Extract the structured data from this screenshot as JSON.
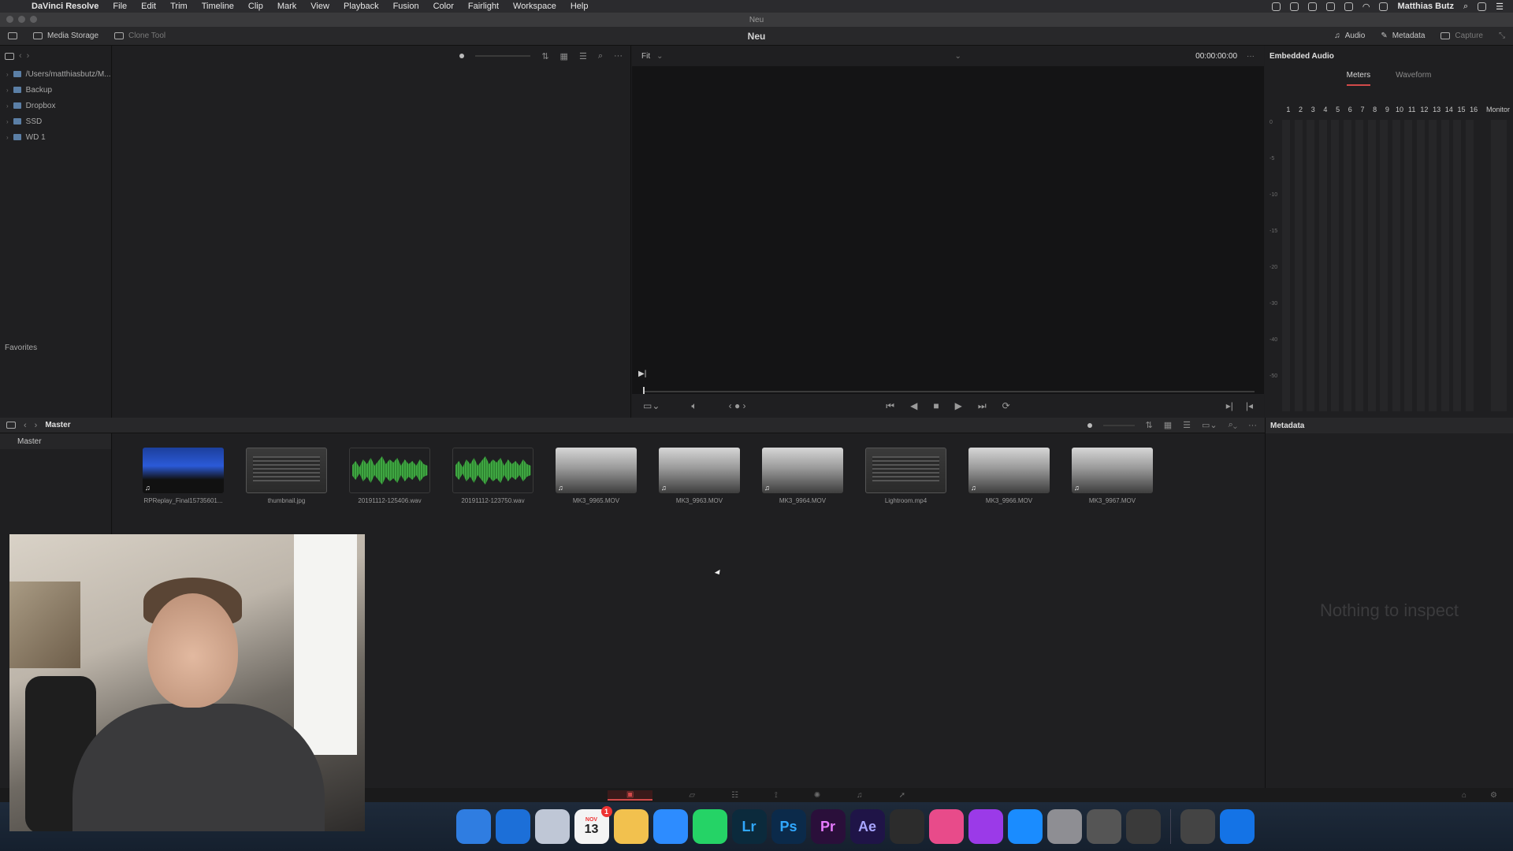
{
  "menubar": {
    "app_name": "DaVinci Resolve",
    "menus": [
      "File",
      "Edit",
      "Trim",
      "Timeline",
      "Clip",
      "Mark",
      "View",
      "Playback",
      "Fusion",
      "Color",
      "Fairlight",
      "Workspace",
      "Help"
    ],
    "user": "Matthias Butz"
  },
  "window": {
    "title": "Neu"
  },
  "toolbar": {
    "media_storage": "Media Storage",
    "clone_tool": "Clone Tool",
    "project_title": "Neu",
    "audio": "Audio",
    "metadata": "Metadata",
    "capture": "Capture"
  },
  "tree": {
    "items": [
      "/Users/matthiasbutz/M...",
      "Backup",
      "Dropbox",
      "SSD",
      "WD 1"
    ],
    "favorites": "Favorites"
  },
  "viewer": {
    "zoom": "Fit",
    "timecode": "00:00:00:00"
  },
  "inspector": {
    "title": "Embedded Audio",
    "tabs": [
      "Meters",
      "Waveform"
    ],
    "active_tab": "Meters",
    "channels": [
      "1",
      "2",
      "3",
      "4",
      "5",
      "6",
      "7",
      "8",
      "9",
      "10",
      "11",
      "12",
      "13",
      "14",
      "15",
      "16"
    ],
    "monitor": "Monitor",
    "db_scale": [
      "0",
      "-5",
      "-10",
      "-15",
      "-20",
      "-30",
      "-40",
      "-50"
    ]
  },
  "bin": {
    "title": "Master",
    "list_item": "Master"
  },
  "clips": [
    {
      "name": "RPReplay_Final15735601...",
      "kind": "replay",
      "audio": true
    },
    {
      "name": "thumbnail.jpg",
      "kind": "screen",
      "audio": false
    },
    {
      "name": "20191112-125406.wav",
      "kind": "audio",
      "audio": false
    },
    {
      "name": "20191112-123750.wav",
      "kind": "audio",
      "audio": false
    },
    {
      "name": "MK3_9965.MOV",
      "kind": "video",
      "audio": true
    },
    {
      "name": "MK3_9963.MOV",
      "kind": "video",
      "audio": true
    },
    {
      "name": "MK3_9964.MOV",
      "kind": "video",
      "audio": true
    },
    {
      "name": "Lightroom.mp4",
      "kind": "screen",
      "audio": false
    },
    {
      "name": "MK3_9966.MOV",
      "kind": "video",
      "audio": true
    },
    {
      "name": "MK3_9967.MOV",
      "kind": "video",
      "audio": true
    }
  ],
  "metadata_panel": {
    "title": "Metadata",
    "empty": "Nothing to inspect"
  },
  "dock": {
    "calendar_month": "NOV",
    "calendar_day": "13",
    "calendar_badge": "1",
    "apps": [
      {
        "name": "finder",
        "label": "",
        "color": "#2f7de1"
      },
      {
        "name": "safari",
        "label": "",
        "color": "#1c6fd8"
      },
      {
        "name": "preview",
        "label": "",
        "color": "#bfc7d6"
      },
      {
        "name": "calendar",
        "label": "13",
        "color": "#f4f4f4"
      },
      {
        "name": "photos",
        "label": "",
        "color": "#f2c14e"
      },
      {
        "name": "messenger",
        "label": "",
        "color": "#2d8cff"
      },
      {
        "name": "whatsapp",
        "label": "",
        "color": "#25d366"
      },
      {
        "name": "lightroom",
        "label": "Lr",
        "color": "#0b2a3c"
      },
      {
        "name": "photoshop",
        "label": "Ps",
        "color": "#0b2a4a"
      },
      {
        "name": "premiere",
        "label": "Pr",
        "color": "#2a0f3a"
      },
      {
        "name": "after-effects",
        "label": "Ae",
        "color": "#1f1447"
      },
      {
        "name": "davinci",
        "label": "",
        "color": "#2c2c2c"
      },
      {
        "name": "itunes",
        "label": "",
        "color": "#e84b8a"
      },
      {
        "name": "podcasts",
        "label": "",
        "color": "#9b3ae8"
      },
      {
        "name": "app-store",
        "label": "",
        "color": "#1a8cff"
      },
      {
        "name": "system-prefs",
        "label": "",
        "color": "#8e8e93"
      },
      {
        "name": "screenshot",
        "label": "",
        "color": "#555"
      },
      {
        "name": "camera-raw",
        "label": "",
        "color": "#3a3a3a"
      },
      {
        "name": "photos-app",
        "label": "",
        "color": "#444"
      },
      {
        "name": "browser",
        "label": "",
        "color": "#1473e6"
      }
    ]
  }
}
